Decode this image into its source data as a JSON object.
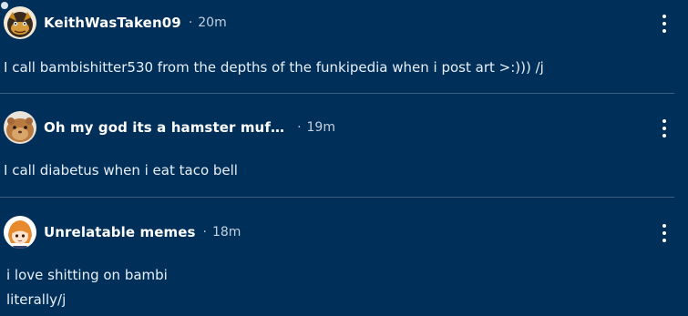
{
  "comments": [
    {
      "username": "KeithWasTaken09",
      "separator": "·",
      "time": "20m",
      "lines": [
        "I call bambishitter530 from the depths of the funkipedia when i post art >:))) /j"
      ]
    },
    {
      "username": "Oh my god its a hamster muf…",
      "separator": "·",
      "time": "19m",
      "lines": [
        "I call diabetus when i eat taco bell"
      ]
    },
    {
      "username": "Unrelatable memes",
      "separator": "·",
      "time": "18m",
      "lines": [
        "i love shitting on bambi",
        "literally/j"
      ]
    }
  ],
  "icons": {
    "more": "more-options-icon",
    "avatar1": "avatar-dark-character",
    "avatar2": "avatar-hamster",
    "avatar3": "avatar-anime-orange-hair"
  },
  "colors": {
    "background": "#00305a",
    "divider": "#3e5f82",
    "text": "#e8eff7",
    "meta": "#c3d0de"
  }
}
